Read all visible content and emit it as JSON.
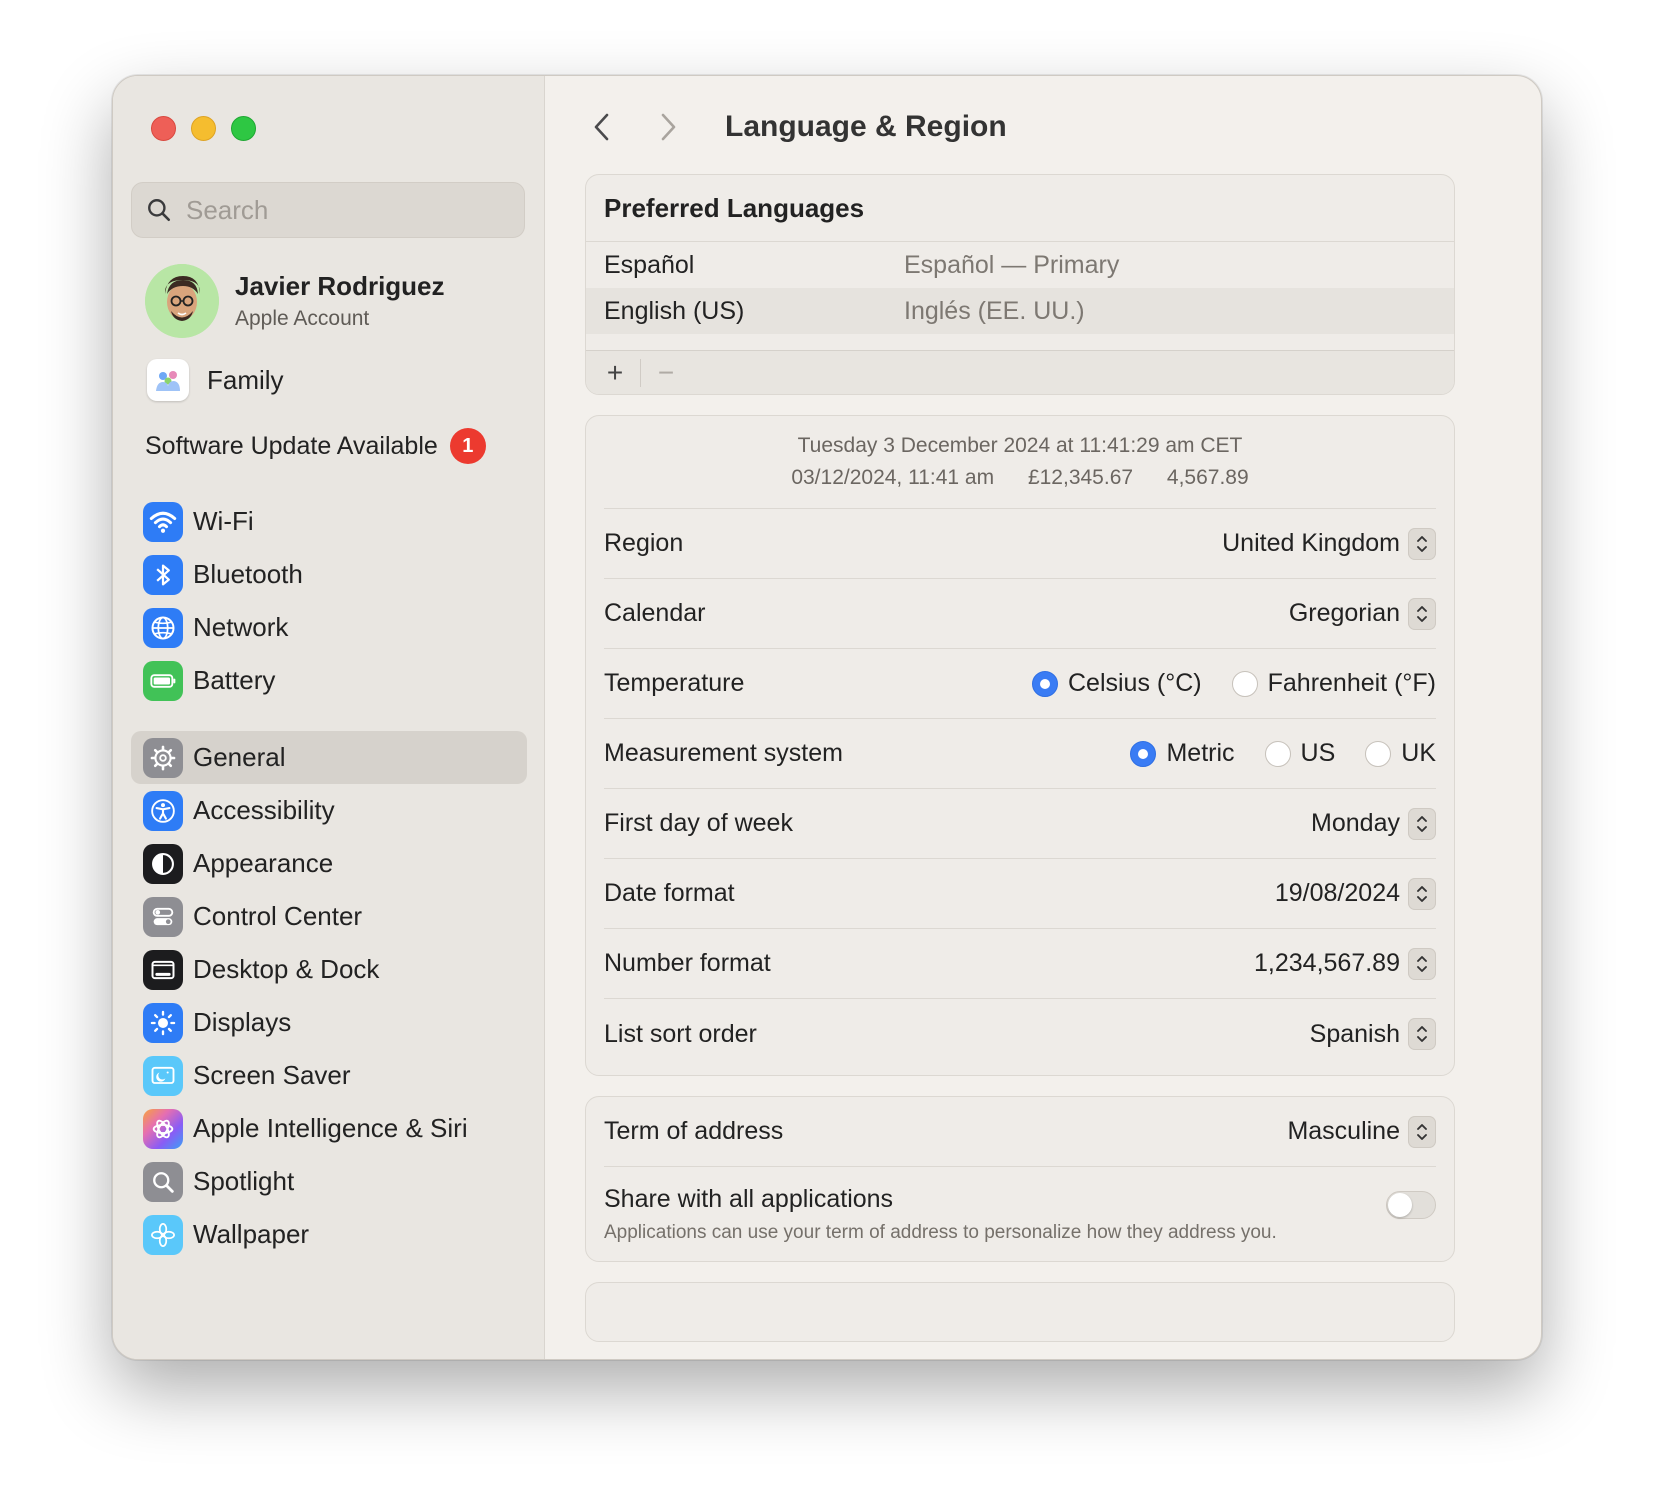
{
  "sidebar": {
    "search_placeholder": "Search",
    "account": {
      "name": "Javier Rodriguez",
      "subtitle": "Apple Account"
    },
    "family_label": "Family",
    "update": {
      "label": "Software Update Available",
      "badge": "1"
    },
    "group1": [
      {
        "label": "Wi-Fi",
        "icon": "wifi-icon",
        "color": "#2e7cf6"
      },
      {
        "label": "Bluetooth",
        "icon": "bluetooth-icon",
        "color": "#2e7cf6"
      },
      {
        "label": "Network",
        "icon": "globe-icon",
        "color": "#2e7cf6"
      },
      {
        "label": "Battery",
        "icon": "battery-icon",
        "color": "#41c257"
      }
    ],
    "group2": [
      {
        "label": "General",
        "icon": "gear-icon",
        "color": "#8e8e93",
        "selected": true
      },
      {
        "label": "Accessibility",
        "icon": "accessibility-icon",
        "color": "#2e7cf6"
      },
      {
        "label": "Appearance",
        "icon": "appearance-icon",
        "color": "#1c1c1e"
      },
      {
        "label": "Control Center",
        "icon": "control-center-icon",
        "color": "#8e8e93"
      },
      {
        "label": "Desktop & Dock",
        "icon": "dock-icon",
        "color": "#1c1c1e"
      },
      {
        "label": "Displays",
        "icon": "sun-icon",
        "color": "#2e7cf6"
      },
      {
        "label": "Screen Saver",
        "icon": "screen-saver-icon",
        "color": "#5ac8fa"
      },
      {
        "label": "Apple Intelligence & Siri",
        "icon": "siri-icon",
        "color": "#e66fb0"
      },
      {
        "label": "Spotlight",
        "icon": "spotlight-icon",
        "color": "#8e8e93"
      },
      {
        "label": "Wallpaper",
        "icon": "wallpaper-icon",
        "color": "#5ac8fa"
      }
    ]
  },
  "header": {
    "title": "Language & Region"
  },
  "preferred_languages": {
    "title": "Preferred Languages",
    "rows": [
      {
        "name": "Español",
        "detail": "Español — Primary"
      },
      {
        "name": "English (US)",
        "detail": "Inglés (EE. UU.)"
      }
    ],
    "add_label": "+",
    "remove_label": "−"
  },
  "preview": {
    "line1": "Tuesday 3 December 2024 at 11:41:29 am CET",
    "date_time": "03/12/2024, 11:41 am",
    "currency": "£12,345.67",
    "number": "4,567.89"
  },
  "settings": {
    "region": {
      "label": "Region",
      "value": "United Kingdom"
    },
    "calendar": {
      "label": "Calendar",
      "value": "Gregorian"
    },
    "temperature": {
      "label": "Temperature",
      "options": [
        "Celsius (°C)",
        "Fahrenheit (°F)"
      ],
      "selected": "Celsius (°C)"
    },
    "measurement": {
      "label": "Measurement system",
      "options": [
        "Metric",
        "US",
        "UK"
      ],
      "selected": "Metric"
    },
    "first_day": {
      "label": "First day of week",
      "value": "Monday"
    },
    "date_format": {
      "label": "Date format",
      "value": "19/08/2024"
    },
    "number_format": {
      "label": "Number format",
      "value": "1,234,567.89"
    },
    "sort_order": {
      "label": "List sort order",
      "value": "Spanish"
    }
  },
  "address": {
    "term": {
      "label": "Term of address",
      "value": "Masculine"
    },
    "share": {
      "title": "Share with all applications",
      "description": "Applications can use your term of address to personalize how they address you.",
      "enabled": false
    }
  },
  "colors": {
    "accent": "#3a7cf4",
    "badge": "#ec3a2f"
  }
}
